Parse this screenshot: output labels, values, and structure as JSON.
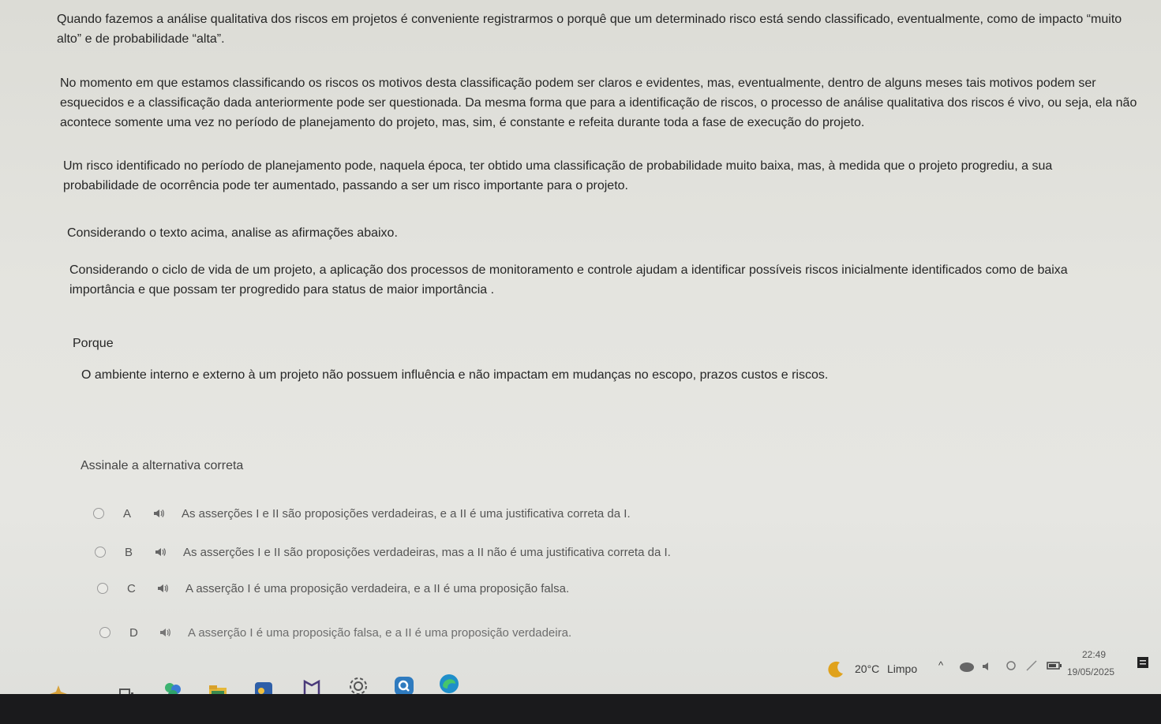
{
  "question": {
    "p1": "Quando fazemos a análise qualitativa dos riscos em projetos é conveniente registrarmos o porquê que um determinado risco está sendo classificado, eventualmente, como de impacto “muito alto” e de probabilidade “alta”.",
    "p2": "No momento em que estamos classificando os riscos os motivos desta classificação podem ser claros e evidentes, mas, eventualmente, dentro de alguns meses tais motivos podem ser esquecidos e a classificação dada anteriormente pode ser questionada. Da mesma forma que para a identificação de riscos, o processo de análise qualitativa dos riscos é vivo, ou seja, ela não acontece somente uma vez no período de planejamento do projeto, mas, sim, é constante e refeita durante toda a fase de execução do projeto.",
    "p3": "Um risco identificado no período de planejamento pode, naquela época, ter obtido uma classificação de probabilidade muito baixa, mas, à medida que o projeto progrediu, a sua probabilidade de ocorrência pode ter aumentado, passando a ser um risco importante para o projeto.",
    "p4": "Considerando o texto acima, analise as afirmações abaixo.",
    "assertion1": "Considerando o ciclo de vida de um projeto, a aplicação dos processos de monitoramento e controle ajudam a identificar possíveis riscos inicialmente identificados como de baixa importância e que possam ter progredido  para  status de maior importância .",
    "connector": "Porque",
    "assertion2": "O ambiente interno e externo à um projeto não possuem influência e não impactam em mudanças no escopo, prazos custos e riscos.",
    "instruction": "Assinale a alternativa correta"
  },
  "options": [
    {
      "letter": "A",
      "text": "As asserções I e II são proposições verdadeiras, e a II é uma justificativa correta da I."
    },
    {
      "letter": "B",
      "text": "As asserções I e II são proposições verdadeiras, mas a II não é uma justificativa correta da I."
    },
    {
      "letter": "C",
      "text": "A asserção I é uma proposição verdadeira, e a II é uma proposição falsa."
    },
    {
      "letter": "D",
      "text": "A asserção I é uma proposição falsa, e a II é uma proposição verdadeira."
    }
  ],
  "taskbar": {
    "weather_temp": "20°C",
    "weather_desc": "Limpo",
    "time": "22:49",
    "date": "19/05/2025",
    "icons": [
      "copilot-icon",
      "widgets-icon",
      "colorful-app-icon",
      "file-explorer-icon",
      "blue-app-icon",
      "notion-like-icon",
      "settings-icon",
      "search-q-icon",
      "edge-icon"
    ]
  },
  "colors": {
    "background": "#e4e4df",
    "text": "#262626",
    "taskbar_dark": "#1a1a1c"
  }
}
